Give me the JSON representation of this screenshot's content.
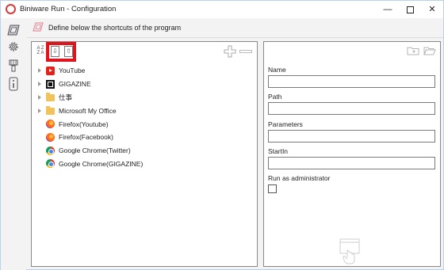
{
  "window": {
    "title": "Biniware Run - Configuration",
    "minimize_glyph": "—",
    "close_glyph": "✕"
  },
  "header": {
    "text": "Define below the shortcuts of the program"
  },
  "rail": {
    "items": [
      {
        "name": "shortcuts-icon"
      },
      {
        "name": "settings-gear-icon"
      },
      {
        "name": "brush-icon"
      },
      {
        "name": "info-icon"
      }
    ]
  },
  "left_toolbar": {
    "sort_label_top": "A Z",
    "sort_label_bottom": "Z A",
    "move_down_glyph": "⇩",
    "move_up_glyph": "⇧"
  },
  "tree": {
    "items": [
      {
        "label": "YouTube",
        "icon": "youtube-icon",
        "expandable": true
      },
      {
        "label": "GIGAZINE",
        "icon": "gigazine-icon",
        "expandable": true
      },
      {
        "label": "仕事",
        "icon": "folder-icon",
        "expandable": true
      },
      {
        "label": "Microsoft My Office",
        "icon": "folder-icon",
        "expandable": true
      },
      {
        "label": "Firefox(Youtube)",
        "icon": "firefox-icon",
        "expandable": false
      },
      {
        "label": "Firefox(Facebook)",
        "icon": "firefox-icon",
        "expandable": false
      },
      {
        "label": "Google Chrome(Twitter)",
        "icon": "chrome-icon",
        "expandable": false
      },
      {
        "label": "Google Chrome(GIGAZINE)",
        "icon": "chrome-icon",
        "expandable": false
      }
    ]
  },
  "form": {
    "name_label": "Name",
    "name_value": "",
    "path_label": "Path",
    "path_value": "",
    "parameters_label": "Parameters",
    "parameters_value": "",
    "startin_label": "StartIn",
    "startin_value": "",
    "run_as_admin_label": "Run as administrator",
    "run_as_admin_checked": false
  },
  "colors": {
    "highlight": "#e2141b",
    "app_accent": "#d83b3b"
  }
}
